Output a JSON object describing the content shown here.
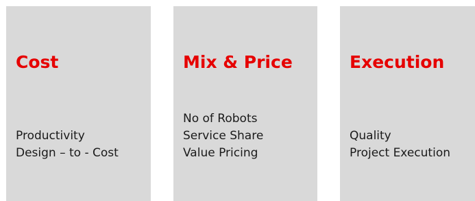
{
  "cards": [
    {
      "title": "Cost",
      "items": [
        "Productivity",
        "Design – to - Cost"
      ]
    },
    {
      "title": "Mix & Price",
      "items": [
        "No of Robots",
        "Service Share",
        "Value Pricing"
      ]
    },
    {
      "title": "Execution",
      "items": [
        "Quality",
        "Project Execution"
      ]
    }
  ],
  "colors": {
    "card_background": "#d9d9d9",
    "title": "#e60000",
    "text": "#1a1a1a"
  }
}
